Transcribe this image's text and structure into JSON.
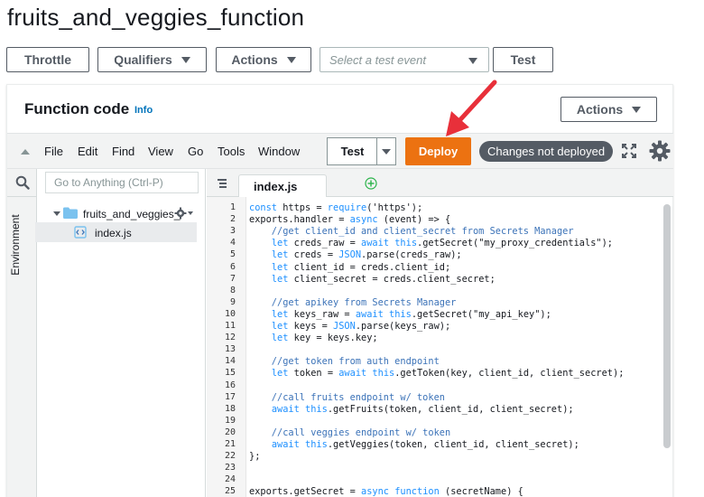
{
  "page_title": "fruits_and_veggies_function",
  "toolbar": {
    "throttle_label": "Throttle",
    "qualifiers_label": "Qualifiers",
    "actions_label": "Actions",
    "test_event_placeholder": "Select a test event",
    "test_label": "Test"
  },
  "function_code": {
    "title": "Function code",
    "info_label": "Info",
    "actions_label": "Actions"
  },
  "ide": {
    "menu": [
      "File",
      "Edit",
      "Find",
      "View",
      "Go",
      "Tools",
      "Window"
    ],
    "test_label": "Test",
    "deploy_label": "Deploy",
    "status_badge": "Changes not deployed",
    "search_placeholder": "Go to Anything (Ctrl-P)",
    "environment_label": "Environment",
    "folder_name": "fruits_and_veggies_",
    "file_name": "index.js",
    "active_tab": "index.js"
  },
  "code": {
    "line_numbers": [
      "1",
      "2",
      "3",
      "4",
      "5",
      "6",
      "7",
      "8",
      "9",
      "10",
      "11",
      "12",
      "13",
      "14",
      "15",
      "16",
      "17",
      "18",
      "19",
      "20",
      "21",
      "22",
      "23",
      "24",
      "25"
    ],
    "lines": [
      "const https = require('https');",
      "exports.handler = async (event) => {",
      "    //get client_id and client_secret from Secrets Manager",
      "    let creds_raw = await this.getSecret(\"my_proxy_credentials\");",
      "    let creds = JSON.parse(creds_raw);",
      "    let client_id = creds.client_id;",
      "    let client_secret = creds.client_secret;",
      "",
      "    //get apikey from Secrets Manager",
      "    let keys_raw = await this.getSecret(\"my_api_key\");",
      "    let keys = JSON.parse(keys_raw);",
      "    let key = keys.key;",
      "",
      "    //get token from auth endpoint",
      "    let token = await this.getToken(key, client_id, client_secret);",
      "",
      "    //call fruits endpoint w/ token",
      "    await this.getFruits(token, client_id, client_secret);",
      "",
      "    //call veggies endpoint w/ token",
      "    await this.getVeggies(token, client_id, client_secret);",
      "};",
      "",
      "",
      "exports.getSecret = async function (secretName) {"
    ]
  },
  "colors": {
    "deploy": "#ec7211",
    "badge": "#545b64",
    "link": "#0073bb",
    "arrow": "#e8303a"
  }
}
